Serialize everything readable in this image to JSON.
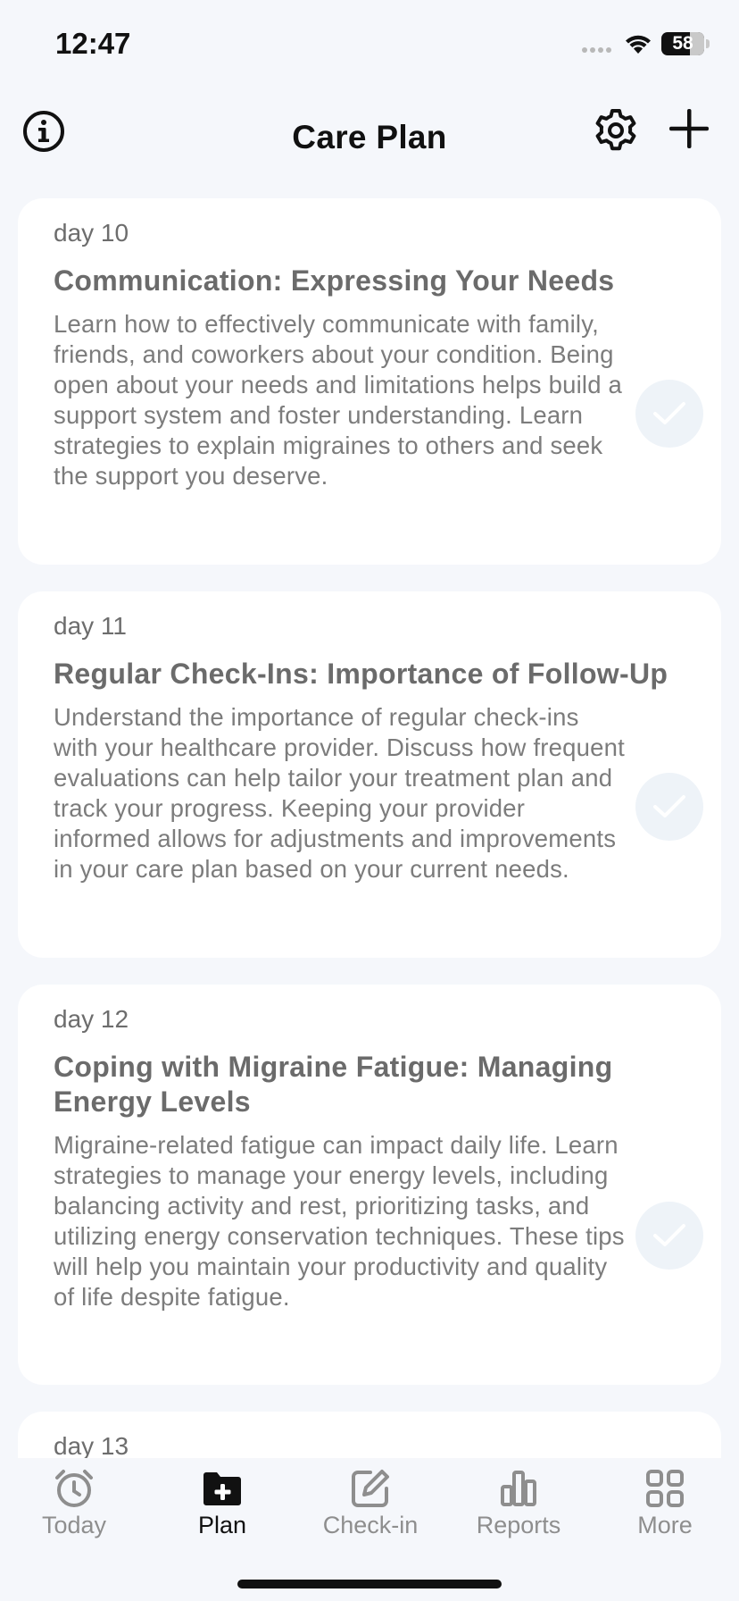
{
  "status_bar": {
    "time": "12:47",
    "battery": "58"
  },
  "header": {
    "title": "Care Plan"
  },
  "cards": [
    {
      "day": "day 10",
      "title": "Communication: Expressing Your Needs",
      "description": "Learn how to effectively communicate with family, friends, and coworkers about your condition. Being open about your needs and limitations helps build a support system and foster understanding. Learn strategies to explain migraines to others and seek the support you deserve."
    },
    {
      "day": "day 11",
      "title": "Regular Check-Ins: Importance of Follow-Up",
      "description": "Understand the importance of regular check-ins with your healthcare provider. Discuss how frequent evaluations can help tailor your treatment plan and track your progress. Keeping your provider informed allows for adjustments and improvements in your care plan based on your current needs."
    },
    {
      "day": "day 12",
      "title": "Coping with Migraine Fatigue: Managing Energy Levels",
      "description": "Migraine-related fatigue can impact daily life. Learn strategies to manage your energy levels, including balancing activity and rest, prioritizing tasks, and utilizing energy conservation techniques. These tips will help you maintain your productivity and quality of life despite fatigue."
    },
    {
      "day": "day 13"
    }
  ],
  "tabs": [
    {
      "label": "Today",
      "icon": "alarm-clock-icon"
    },
    {
      "label": "Plan",
      "icon": "folder-plus-icon"
    },
    {
      "label": "Check-in",
      "icon": "edit-square-icon"
    },
    {
      "label": "Reports",
      "icon": "bar-chart-icon"
    },
    {
      "label": "More",
      "icon": "grid-icon"
    }
  ],
  "colors": {
    "accent": "#111111",
    "inactive": "#8e8e8e",
    "check_bg": "#eef3f8"
  }
}
